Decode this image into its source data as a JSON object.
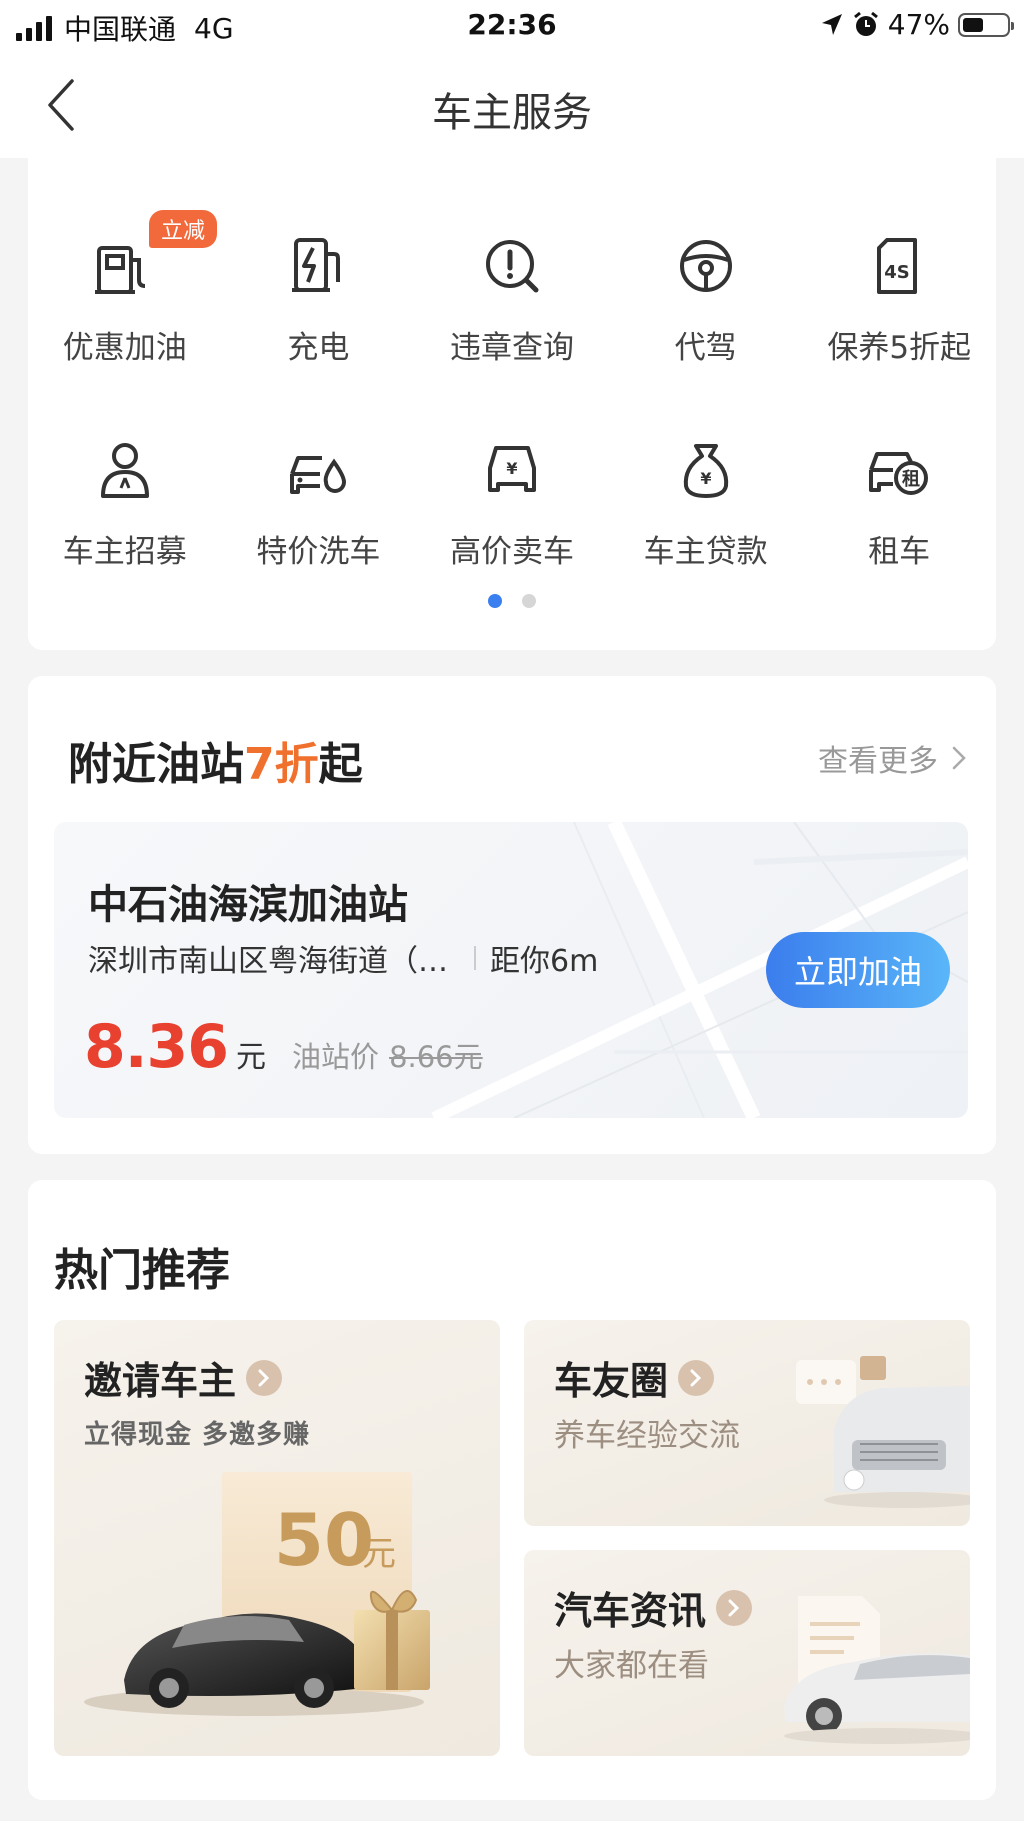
{
  "status_bar": {
    "carrier": "中国联通",
    "network": "4G",
    "time": "22:36",
    "battery": "47%",
    "battery_level": 0.47
  },
  "nav": {
    "title": "车主服务"
  },
  "services": {
    "items": [
      {
        "label": "优惠加油",
        "icon": "fuel-pump-icon",
        "badge": "立减"
      },
      {
        "label": "充电",
        "icon": "charging-station-icon"
      },
      {
        "label": "违章查询",
        "icon": "violation-search-icon"
      },
      {
        "label": "代驾",
        "icon": "steering-wheel-icon"
      },
      {
        "label": "保养5折起",
        "icon": "maintenance-4s-icon"
      },
      {
        "label": "车主招募",
        "icon": "driver-recruit-icon"
      },
      {
        "label": "特价洗车",
        "icon": "car-wash-icon"
      },
      {
        "label": "高价卖车",
        "icon": "sell-car-icon"
      },
      {
        "label": "车主贷款",
        "icon": "money-bag-icon"
      },
      {
        "label": "租车",
        "icon": "car-rental-icon"
      }
    ],
    "pages": 2,
    "active_page": 1
  },
  "nearby": {
    "title_prefix": "附近油站",
    "title_highlight": "7折",
    "title_suffix": "起",
    "more_label": "查看更多",
    "station": {
      "name": "中石油海滨加油站",
      "address": "深圳市南山区粤海街道（…",
      "distance": "距你6m",
      "price": "8.36",
      "price_unit": "元",
      "station_price_label": "油站价",
      "station_price": "8.66元",
      "button": "立即加油"
    }
  },
  "hot": {
    "title": "热门推荐",
    "invite": {
      "title": "邀请车主",
      "subtitle": "立得现金  多邀多赚",
      "voucher_amount": "50",
      "voucher_unit": "元"
    },
    "club": {
      "title": "车友圈",
      "subtitle": "养车经验交流"
    },
    "news": {
      "title": "汽车资讯",
      "subtitle": "大家都在看"
    }
  },
  "colors": {
    "accent_orange": "#f0702d",
    "price_red": "#e8412f",
    "button_blue": "#3b7ded",
    "dot_active": "#3a7ff0"
  }
}
